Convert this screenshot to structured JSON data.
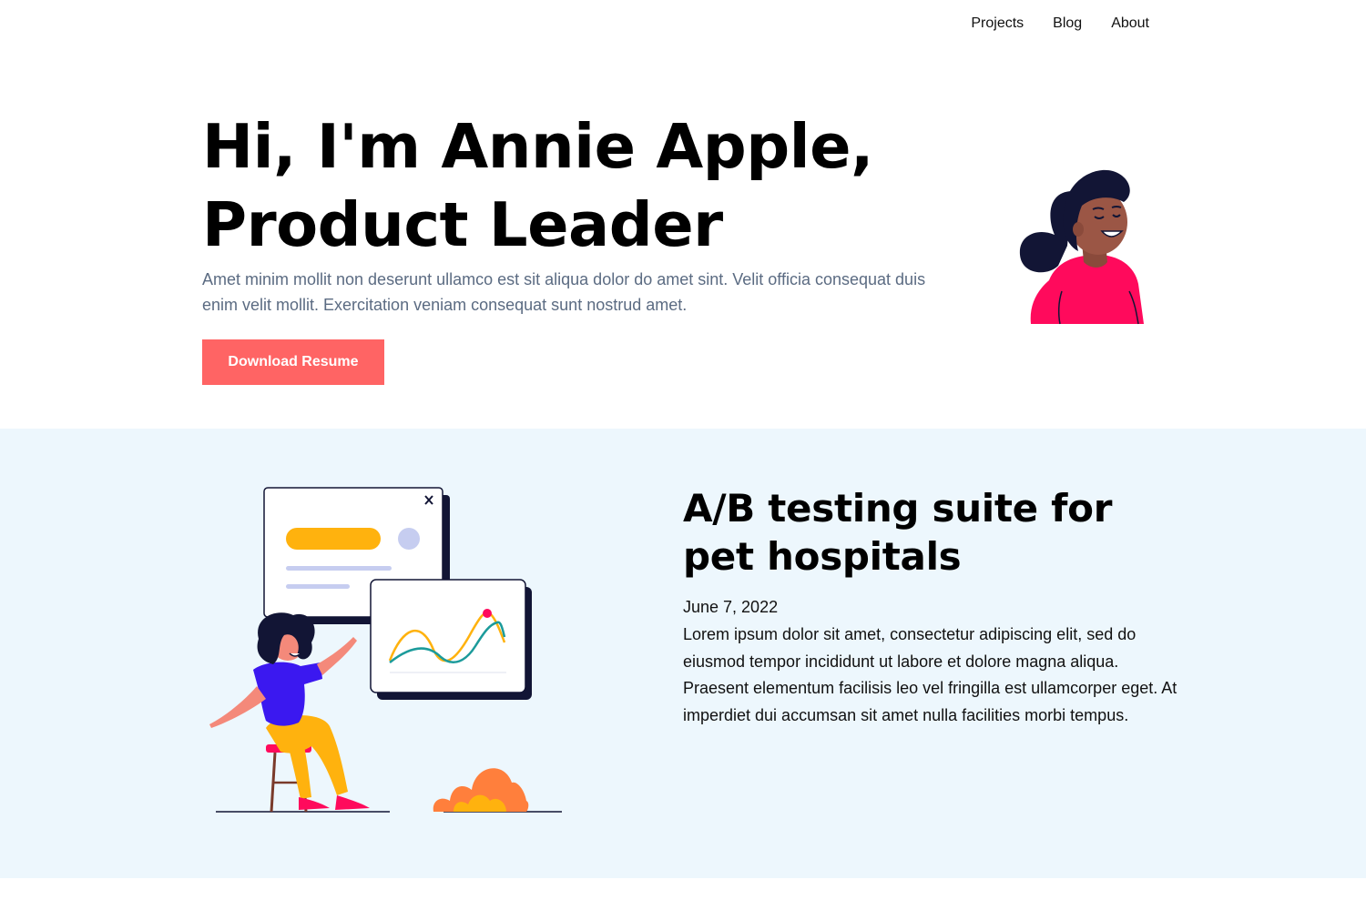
{
  "nav": {
    "items": [
      {
        "label": "Projects"
      },
      {
        "label": "Blog"
      },
      {
        "label": "About"
      }
    ]
  },
  "hero": {
    "title_line1": "Hi, I'm Annie Apple,",
    "title_line2": "Product Leader",
    "description": "Amet minim mollit non deserunt ullamco est sit aliqua dolor do amet sint. Velit officia consequat duis enim velit mollit. Exercitation veniam consequat sunt nostrud amet.",
    "button_label": "Download Resume"
  },
  "featured": {
    "title": "A/B testing suite for pet hospitals",
    "date": "June 7, 2022",
    "body": "Lorem ipsum dolor sit amet, consectetur adipiscing elit, sed do eiusmod tempor incididunt ut labore et dolore magna aliqua. Praesent elementum facilisis leo vel fringilla est ullamcorper eget. At imperdiet dui accumsan sit amet nulla facilities morbi tempus."
  },
  "icons": {
    "avatar": "woman-avatar-icon",
    "illustration": "analytics-dashboard-illustration",
    "close": "close-icon"
  },
  "colors": {
    "accent": "#ff6464",
    "section_bg": "#edf7fd",
    "muted_text": "#5b6b82"
  }
}
